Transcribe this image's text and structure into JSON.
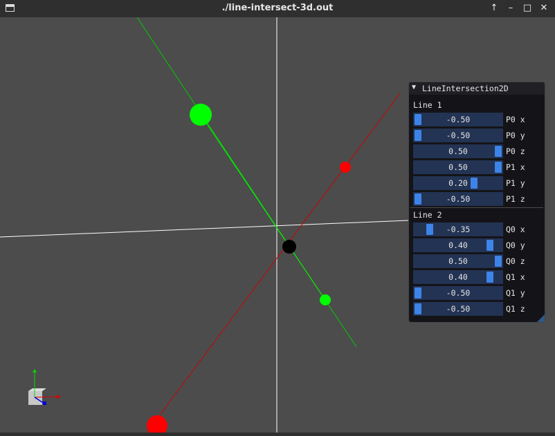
{
  "window": {
    "title": "./line-intersect-3d.out"
  },
  "panel": {
    "title": "LineIntersection2D",
    "sections": [
      {
        "label": "Line 1",
        "sliders": [
          {
            "value": "-0.50",
            "label": "P0 x",
            "fraction": 0.0
          },
          {
            "value": "-0.50",
            "label": "P0 y",
            "fraction": 0.0
          },
          {
            "value": "0.50",
            "label": "P0 z",
            "fraction": 1.0
          },
          {
            "value": "0.50",
            "label": "P1 x",
            "fraction": 1.0
          },
          {
            "value": "0.20",
            "label": "P1 y",
            "fraction": 0.7
          },
          {
            "value": "-0.50",
            "label": "P1 z",
            "fraction": 0.0
          }
        ]
      },
      {
        "label": "Line 2",
        "sliders": [
          {
            "value": "-0.35",
            "label": "Q0 x",
            "fraction": 0.15
          },
          {
            "value": "0.40",
            "label": "Q0 y",
            "fraction": 0.9
          },
          {
            "value": "0.50",
            "label": "Q0 z",
            "fraction": 1.0
          },
          {
            "value": "0.40",
            "label": "Q1 x",
            "fraction": 0.9
          },
          {
            "value": "-0.50",
            "label": "Q1 y",
            "fraction": 0.0
          },
          {
            "value": "-0.50",
            "label": "Q1 z",
            "fraction": 0.0
          }
        ]
      }
    ]
  },
  "colors": {
    "background": "#4c4c4c",
    "line1": "#00ff00",
    "line2": "#ff0000",
    "intersection": "#000000",
    "axis": "#ffffff",
    "slider_frame": "#233353",
    "slider_grab": "#3d84e8"
  },
  "icons": [
    "window-menu-icon",
    "keep-above-icon",
    "minimize-icon",
    "maximize-icon",
    "close-icon",
    "collapse-arrow-icon",
    "axis-gizmo-icon"
  ]
}
